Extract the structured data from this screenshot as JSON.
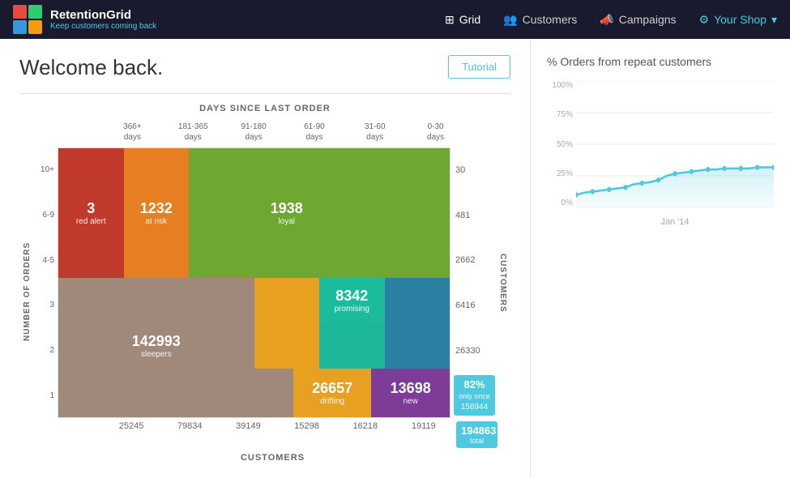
{
  "navbar": {
    "brand_name": "RetentionGrid",
    "brand_tagline": "Keep customers coming back",
    "nav_items": [
      {
        "id": "grid",
        "label": "Grid",
        "active": true,
        "icon": "⊞"
      },
      {
        "id": "customers",
        "label": "Customers",
        "active": false,
        "icon": "👥"
      },
      {
        "id": "campaigns",
        "label": "Campaigns",
        "active": false,
        "icon": "📣"
      },
      {
        "id": "your-shop",
        "label": "Your Shop",
        "active": false,
        "icon": "⚙"
      }
    ]
  },
  "main": {
    "welcome_title": "Welcome back.",
    "tutorial_label": "Tutorial",
    "grid_title": "DAYS SINCE LAST ORDER",
    "y_axis_label": "NUMBER OF ORDERS",
    "x_axis_label": "CUSTOMERS",
    "customers_side_label": "CUSTOMERS",
    "col_headers": [
      {
        "line1": "366+",
        "line2": "days"
      },
      {
        "line1": "181-365",
        "line2": "days"
      },
      {
        "line1": "91-180",
        "line2": "days"
      },
      {
        "line1": "61-90",
        "line2": "days"
      },
      {
        "line1": "31-60",
        "line2": "days"
      },
      {
        "line1": "0-30",
        "line2": "days"
      }
    ],
    "row_labels": [
      "10+",
      "6-9",
      "4-5",
      "3",
      "2",
      "1"
    ],
    "right_counts": [
      "30",
      "481",
      "2662",
      "6416",
      "26330",
      ""
    ],
    "bottom_counts": [
      "25245",
      "79834",
      "39149",
      "15298",
      "16218",
      "19119"
    ],
    "bottom_total": "194863\ntotal",
    "grid_cells": {
      "row_10plus": [
        {
          "color": "red",
          "value": "",
          "label": "",
          "span": 1
        },
        {
          "color": "orange",
          "value": "",
          "label": "",
          "span": 1
        },
        {
          "color": "green",
          "value": "",
          "label": "",
          "span": 1
        },
        {
          "color": "green",
          "value": "",
          "label": "",
          "span": 1
        },
        {
          "color": "green",
          "value": "",
          "label": "",
          "span": 1
        },
        {
          "color": "green",
          "value": "",
          "label": "",
          "span": 1
        }
      ],
      "row_6to9": [
        {
          "color": "red",
          "value": "3",
          "label": "red alert"
        },
        {
          "color": "orange",
          "value": "1232",
          "label": "at risk"
        },
        {
          "color": "green",
          "value": "",
          "label": ""
        },
        {
          "color": "green",
          "value": "1938",
          "label": "loyal"
        },
        {
          "color": "green",
          "value": "",
          "label": ""
        },
        {
          "color": "green",
          "value": "",
          "label": ""
        }
      ]
    }
  },
  "chart": {
    "title": "% Orders from repeat customers",
    "y_labels": [
      "100%",
      "75%",
      "50%",
      "25%",
      "0%"
    ],
    "x_label": "Jan '14",
    "color": "#4ec9e0"
  }
}
